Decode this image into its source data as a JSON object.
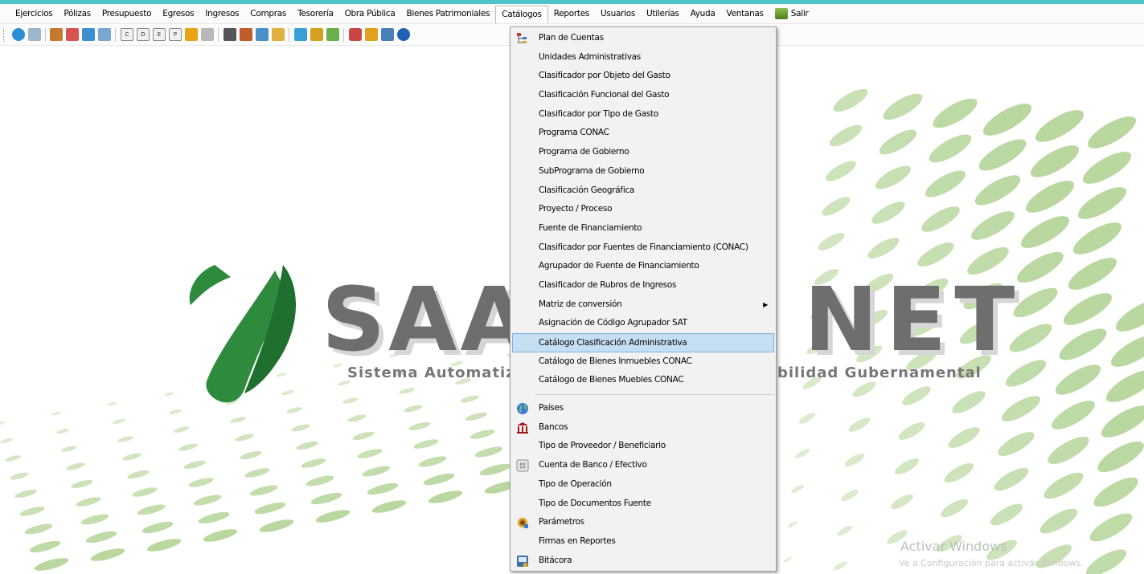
{
  "menubar": {
    "items": [
      "Ejercicios",
      "Pólizas",
      "Presupuesto",
      "Egresos",
      "Ingresos",
      "Compras",
      "Tesorería",
      "Obra Pública",
      "Bienes Patrimoniales",
      "Catálogos",
      "Reportes",
      "Usuarios",
      "Utilerías",
      "Ayuda",
      "Ventanas"
    ],
    "salir_label": "Salir",
    "active": "Catálogos"
  },
  "logo": {
    "left_text": "SAA",
    "right_text": "NET",
    "tagline_left": "Sistema Automatiz",
    "tagline_right": "bilidad Gubernamental"
  },
  "catalogos_menu": {
    "group1": [
      {
        "label": "Plan de Cuentas",
        "icon": "tree-icon"
      },
      {
        "label": "Unidades Administrativas"
      },
      {
        "label": "Clasificador por Objeto del Gasto"
      },
      {
        "label": "Clasificación Funcional del Gasto"
      },
      {
        "label": "Clasificador por Tipo de Gasto"
      },
      {
        "label": "Programa CONAC"
      },
      {
        "label": "Programa de Gobierno"
      },
      {
        "label": "SubPrograma de Gobierno"
      },
      {
        "label": "Clasificación Geográfica"
      },
      {
        "label": "Proyecto / Proceso"
      },
      {
        "label": "Fuente de Financiamiento"
      },
      {
        "label": "Clasificador por Fuentes de Financiamiento (CONAC)"
      },
      {
        "label": "Agrupador de Fuente de Financiamiento"
      },
      {
        "label": "Clasificador de Rubros de Ingresos"
      },
      {
        "label": "Matriz de conversión",
        "submenu": true
      },
      {
        "label": "Asignación de Código Agrupador SAT"
      },
      {
        "label": "Catálogo Clasificación Administrativa",
        "highlighted": true
      },
      {
        "label": "Catálogo de Bienes Inmuebles CONAC"
      },
      {
        "label": "Catálogo de Bienes Muebles CONAC"
      }
    ],
    "group2": [
      {
        "label": "Países",
        "icon": "globe-icon"
      },
      {
        "label": "Bancos",
        "icon": "bank-icon"
      },
      {
        "label": "Tipo de Proveedor / Beneficiario"
      },
      {
        "label": "Cuenta de Banco / Efectivo",
        "icon": "calculator-icon"
      },
      {
        "label": "Tipo de Operación"
      },
      {
        "label": "Tipo de Documentos Fuente"
      },
      {
        "label": "Parámetros",
        "icon": "gear-icon"
      },
      {
        "label": "Firmas en Reportes"
      },
      {
        "label": "Bitácora",
        "icon": "log-icon"
      }
    ]
  },
  "watermark": {
    "title": "Activar Windows",
    "subtitle": "Ve a Configuración para activar Windows."
  },
  "colors": {
    "title_strip": "#52c2c9",
    "logo_green": "#2e8b3e",
    "dots_green": "#b5d59a",
    "highlight": "#c6def2"
  }
}
